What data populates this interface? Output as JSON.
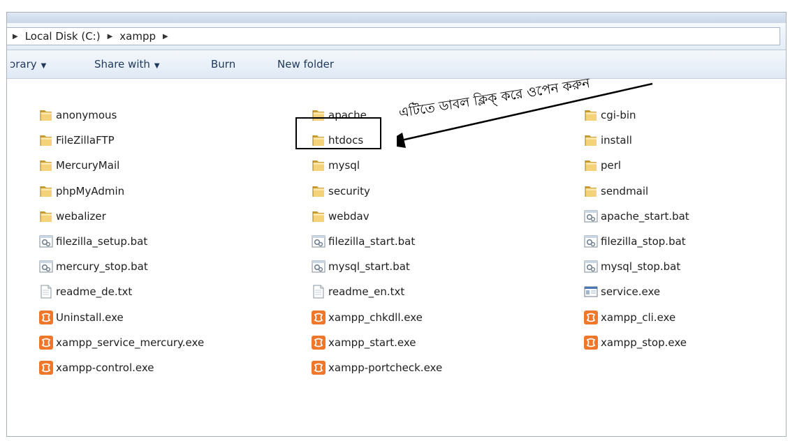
{
  "address": {
    "crumbs": [
      "Local Disk (C:)",
      "xampp"
    ]
  },
  "toolbar": {
    "library_label": "ɔrary",
    "share_label": "Share with",
    "burn_label": "Burn",
    "newfolder_label": "New folder"
  },
  "annotation": {
    "text": "এটিতে ডাবল ক্লিক্‌ করে ওপেন করুন"
  },
  "files": {
    "col1": [
      {
        "name": "anonymous",
        "icon": "folder-icon"
      },
      {
        "name": "FileZillaFTP",
        "icon": "folder-icon"
      },
      {
        "name": "MercuryMail",
        "icon": "folder-icon"
      },
      {
        "name": "phpMyAdmin",
        "icon": "folder-icon"
      },
      {
        "name": "webalizer",
        "icon": "folder-icon"
      },
      {
        "name": "filezilla_setup.bat",
        "icon": "batch-file-icon"
      },
      {
        "name": "mercury_stop.bat",
        "icon": "batch-file-icon"
      },
      {
        "name": "readme_de.txt",
        "icon": "text-file-icon"
      },
      {
        "name": "Uninstall.exe",
        "icon": "xampp-exe-icon"
      },
      {
        "name": "xampp_service_mercury.exe",
        "icon": "xampp-exe-icon"
      },
      {
        "name": "xampp-control.exe",
        "icon": "xampp-exe-icon"
      }
    ],
    "col2": [
      {
        "name": "apache",
        "icon": "folder-icon"
      },
      {
        "name": "htdocs",
        "icon": "folder-icon"
      },
      {
        "name": "mysql",
        "icon": "folder-icon"
      },
      {
        "name": "security",
        "icon": "folder-icon"
      },
      {
        "name": "webdav",
        "icon": "folder-icon"
      },
      {
        "name": "filezilla_start.bat",
        "icon": "batch-file-icon"
      },
      {
        "name": "mysql_start.bat",
        "icon": "batch-file-icon"
      },
      {
        "name": "readme_en.txt",
        "icon": "text-file-icon"
      },
      {
        "name": "xampp_chkdll.exe",
        "icon": "xampp-exe-icon"
      },
      {
        "name": "xampp_start.exe",
        "icon": "xampp-exe-icon"
      },
      {
        "name": "xampp-portcheck.exe",
        "icon": "xampp-exe-icon"
      }
    ],
    "col3": [
      {
        "name": "cgi-bin",
        "icon": "folder-icon"
      },
      {
        "name": "install",
        "icon": "folder-icon"
      },
      {
        "name": "perl",
        "icon": "folder-icon"
      },
      {
        "name": "sendmail",
        "icon": "folder-icon"
      },
      {
        "name": "apache_start.bat",
        "icon": "batch-file-icon"
      },
      {
        "name": "filezilla_stop.bat",
        "icon": "batch-file-icon"
      },
      {
        "name": "mysql_stop.bat",
        "icon": "batch-file-icon"
      },
      {
        "name": "service.exe",
        "icon": "service-exe-icon"
      },
      {
        "name": "xampp_cli.exe",
        "icon": "xampp-exe-icon"
      },
      {
        "name": "xampp_stop.exe",
        "icon": "xampp-exe-icon"
      }
    ]
  }
}
